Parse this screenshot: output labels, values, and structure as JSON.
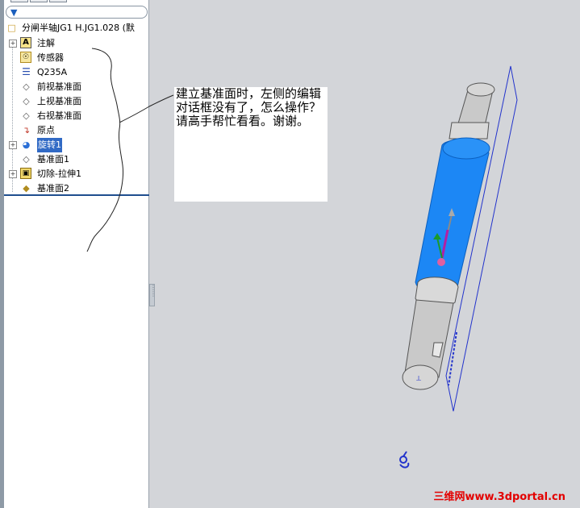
{
  "feature_tree": {
    "root_label": "分闸半轴JG1 H.JG1.028 (默",
    "items": [
      {
        "label": "注解",
        "icon": "annotation-icon",
        "expandable": true
      },
      {
        "label": "传感器",
        "icon": "sensor-icon",
        "expandable": false
      },
      {
        "label": "Q235A",
        "icon": "material-icon",
        "expandable": false
      },
      {
        "label": "前视基准面",
        "icon": "plane-icon",
        "expandable": false
      },
      {
        "label": "上视基准面",
        "icon": "plane-icon",
        "expandable": false
      },
      {
        "label": "右视基准面",
        "icon": "plane-icon",
        "expandable": false
      },
      {
        "label": "原点",
        "icon": "origin-icon",
        "expandable": false
      },
      {
        "label": "旋转1",
        "icon": "revolve-icon",
        "expandable": true,
        "selected": true
      },
      {
        "label": "基准面1",
        "icon": "plane-icon",
        "expandable": false
      },
      {
        "label": "切除-拉伸1",
        "icon": "cut-extrude-icon",
        "expandable": true
      },
      {
        "label": "基准面2",
        "icon": "plane-icon",
        "expandable": false
      }
    ]
  },
  "question_note": {
    "text": "建立基准面时，左侧的编辑对话框没有了，怎么操作？请高手帮忙看看。谢谢。"
  },
  "watermark": {
    "text": "三维网www.3dportal.cn"
  },
  "colors": {
    "viewport_bg": "#d3d5d9",
    "selected_face": "#1c87f5",
    "plane_outline": "#2233cc",
    "watermark": "#e30000"
  }
}
